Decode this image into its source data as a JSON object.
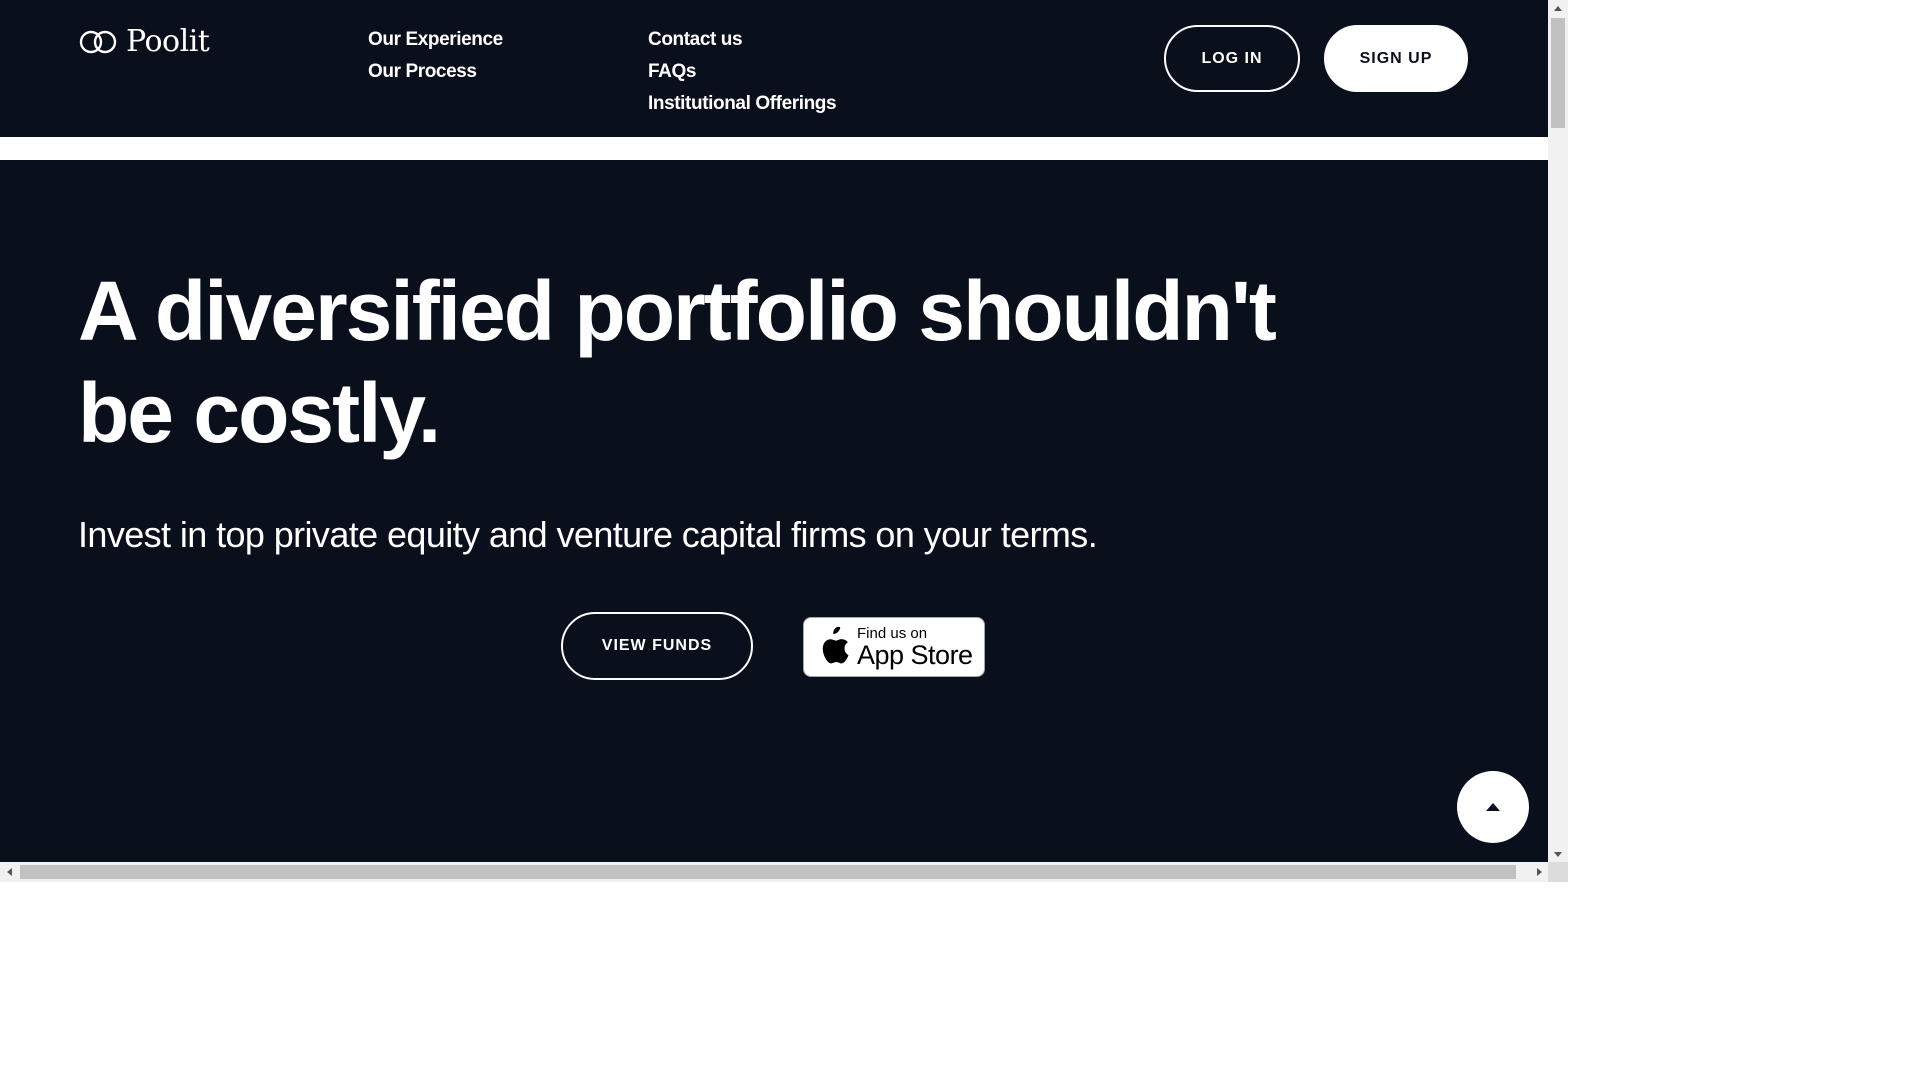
{
  "header": {
    "brand": "Poolit",
    "nav_col1": [
      "Our Experience",
      "Our Process"
    ],
    "nav_col2": [
      "Contact us",
      "FAQs",
      "Institutional Offerings"
    ],
    "login_label": "LOG IN",
    "signup_label": "SIGN UP"
  },
  "hero": {
    "headline": "A diversified portfolio shouldn't be costly.",
    "subhead": "Invest in top private equity and venture capital firms on your terms.",
    "view_funds_label": "VIEW FUNDS",
    "appstore": {
      "small": "Find us on",
      "big": "App Store"
    }
  },
  "colors": {
    "background": "#0a0f1c",
    "text": "#ffffff"
  },
  "icons": {
    "logo": "poolit-logo-icon",
    "apple": "apple-icon",
    "back_to_top": "caret-up-icon"
  }
}
